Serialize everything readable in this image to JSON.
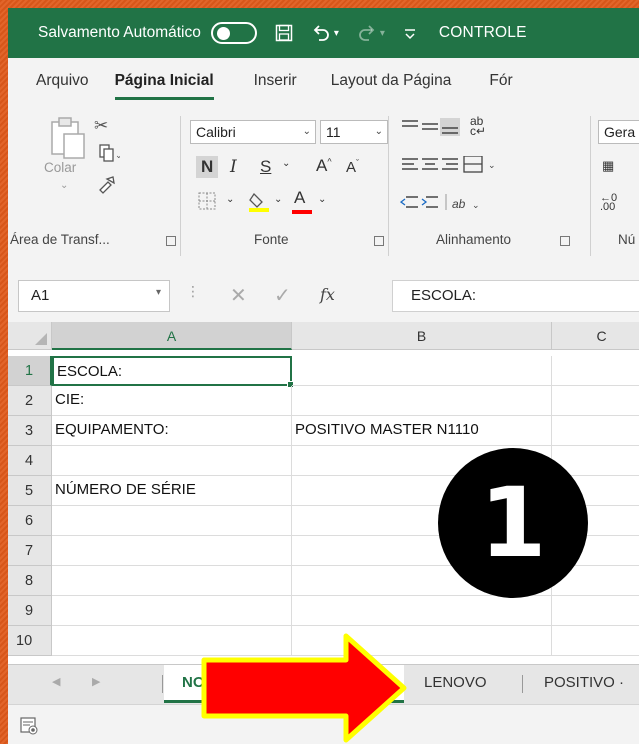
{
  "titlebar": {
    "autosave_label": "Salvamento Automático",
    "document_name": "CONTROLE"
  },
  "ribbon_tabs": [
    "Arquivo",
    "Página Inicial",
    "Inserir",
    "Layout da Página",
    "Fór"
  ],
  "ribbon": {
    "clipboard": {
      "paste_label": "Colar",
      "group_label": "Área de Transf..."
    },
    "font": {
      "font_name": "Calibri",
      "font_size": "11",
      "bold": "N",
      "italic": "I",
      "underline": "S",
      "grow": "A",
      "shrink": "A",
      "font_color_letter": "A",
      "group_label": "Fonte"
    },
    "alignment": {
      "wrap_label": "ab",
      "group_label": "Alinhamento"
    },
    "number": {
      "format": "Gera",
      "group_label": "Nú"
    }
  },
  "formula_bar": {
    "name_box": "A1",
    "fx": "fx",
    "content": "ESCOLA:"
  },
  "columns": [
    "A",
    "B",
    "C"
  ],
  "rows": [
    {
      "num": "1",
      "a": "ESCOLA:",
      "b": ""
    },
    {
      "num": "2",
      "a": "CIE:",
      "b": ""
    },
    {
      "num": "3",
      "a": "EQUIPAMENTO:",
      "b": "POSITIVO MASTER N1110"
    },
    {
      "num": "4",
      "a": "",
      "b": ""
    },
    {
      "num": "5",
      "a": "NÚMERO DE SÉRIE",
      "b": ""
    },
    {
      "num": "6",
      "a": "",
      "b": ""
    },
    {
      "num": "7",
      "a": "",
      "b": ""
    },
    {
      "num": "8",
      "a": "",
      "b": ""
    },
    {
      "num": "9",
      "a": "",
      "b": ""
    },
    {
      "num": "10",
      "a": "",
      "b": ""
    }
  ],
  "sheet_tabs": [
    "NO",
    "LENOVO",
    "POSITIVO"
  ],
  "overlay": {
    "badge_number": "1",
    "arrow_color": "#ff0000",
    "arrow_outline": "#ffff00"
  },
  "colors": {
    "accent": "#217346",
    "background": "#e2652a"
  }
}
